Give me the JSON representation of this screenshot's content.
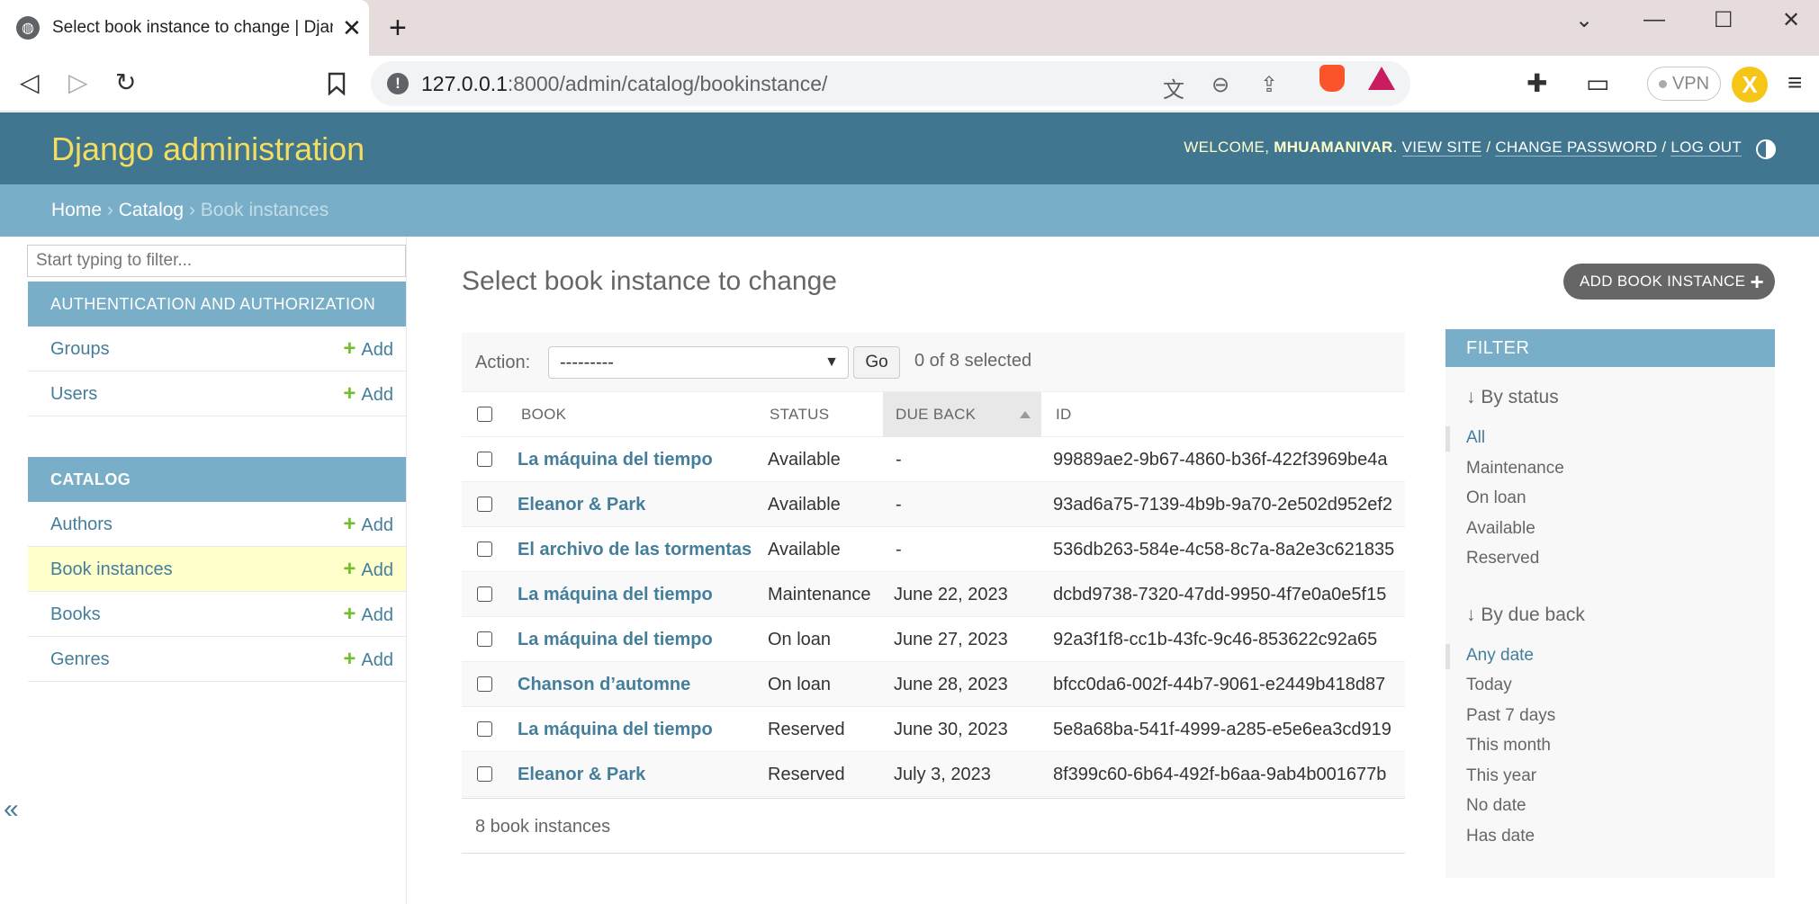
{
  "browser": {
    "tab_title": "Select book instance to change | Django",
    "url_host": "127.0.0.1",
    "url_path": ":8000/admin/catalog/bookinstance/",
    "vpn_label": "VPN"
  },
  "header": {
    "branding": "Django administration",
    "welcome": "WELCOME,",
    "username": "MHUAMANIVAR",
    "view_site": "VIEW SITE",
    "change_password": "CHANGE PASSWORD",
    "log_out": "LOG OUT",
    "sep": "/"
  },
  "breadcrumbs": {
    "home": "Home",
    "catalog": "Catalog",
    "current": "Book instances",
    "sep": "›"
  },
  "sidebar": {
    "filter_placeholder": "Start typing to filter...",
    "collapse_glyph": "«",
    "modules": [
      {
        "caption": "AUTHENTICATION AND AUTHORIZATION",
        "models": [
          {
            "name": "Groups",
            "add": "Add"
          },
          {
            "name": "Users",
            "add": "Add"
          }
        ]
      },
      {
        "caption": "CATALOG",
        "models": [
          {
            "name": "Authors",
            "add": "Add"
          },
          {
            "name": "Book instances",
            "add": "Add"
          },
          {
            "name": "Books",
            "add": "Add"
          },
          {
            "name": "Genres",
            "add": "Add"
          }
        ]
      }
    ]
  },
  "main": {
    "title": "Select book instance to change",
    "add_button": "ADD BOOK INSTANCE",
    "action_label": "Action:",
    "action_selected": "---------",
    "go": "Go",
    "selected_count": "0 of 8 selected",
    "columns": [
      "BOOK",
      "STATUS",
      "DUE BACK",
      "ID"
    ],
    "rows": [
      {
        "book": "La máquina del tiempo",
        "status": "Available",
        "due_back": "-",
        "id": "99889ae2-9b67-4860-b36f-422f3969be4a"
      },
      {
        "book": "Eleanor & Park",
        "status": "Available",
        "due_back": "-",
        "id": "93ad6a75-7139-4b9b-9a70-2e502d952ef2"
      },
      {
        "book": "El archivo de las tormentas",
        "status": "Available",
        "due_back": "-",
        "id": "536db263-584e-4c58-8c7a-8a2e3c621835"
      },
      {
        "book": "La máquina del tiempo",
        "status": "Maintenance",
        "due_back": "June 22, 2023",
        "id": "dcbd9738-7320-47dd-9950-4f7e0a0e5f15"
      },
      {
        "book": "La máquina del tiempo",
        "status": "On loan",
        "due_back": "June 27, 2023",
        "id": "92a3f1f8-cc1b-43fc-9c46-853622c92a65"
      },
      {
        "book": "Chanson d’automne",
        "status": "On loan",
        "due_back": "June 28, 2023",
        "id": "bfcc0da6-002f-44b7-9061-e2449b418d87"
      },
      {
        "book": "La máquina del tiempo",
        "status": "Reserved",
        "due_back": "June 30, 2023",
        "id": "5e8a68ba-541f-4999-a285-e5e6ea3cd919"
      },
      {
        "book": "Eleanor & Park",
        "status": "Reserved",
        "due_back": "July 3, 2023",
        "id": "8f399c60-6b64-492f-b6aa-9ab4b001677b"
      }
    ],
    "paginator": "8 book instances"
  },
  "filter": {
    "caption": "FILTER",
    "groups": [
      {
        "title": "↓ By status",
        "items": [
          "All",
          "Maintenance",
          "On loan",
          "Available",
          "Reserved"
        ],
        "selected": "All"
      },
      {
        "title": "↓ By due back",
        "items": [
          "Any date",
          "Today",
          "Past 7 days",
          "This month",
          "This year",
          "No date",
          "Has date"
        ],
        "selected": "Any date"
      }
    ]
  },
  "colors": {
    "header": "#417690",
    "breadcrumbs": "#79aec8",
    "link": "#447e9b",
    "branding": "#f5dd5d",
    "add_green": "#70bf2b",
    "current_row": "#ffffcc"
  }
}
